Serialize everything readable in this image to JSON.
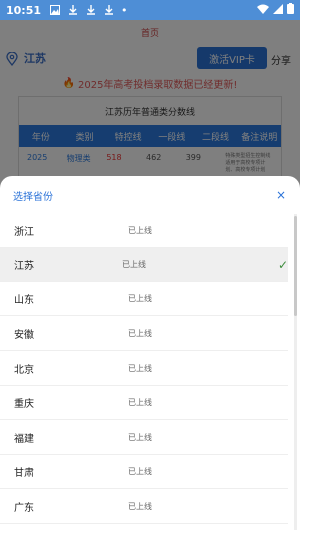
{
  "statusbar": {
    "time": "10:51",
    "dot": "•"
  },
  "appbar": {
    "title": "首页"
  },
  "filter": {
    "region": "江苏",
    "vip_label": "激活VIP卡",
    "share_label": "分享"
  },
  "banner": {
    "text": "2025年高考投档录取数据已经更新!"
  },
  "card": {
    "title": "江苏历年普通类分数线",
    "headers": [
      "年份",
      "类别",
      "特控线",
      "一段线",
      "二段线",
      "备注说明"
    ],
    "first_row": {
      "year": "2025",
      "type": "物理类",
      "special": "518",
      "one": "462",
      "two": "399",
      "note": "特殊类型招生控制线\n适用于高校专项计划、高校专项计划"
    }
  },
  "sheet": {
    "title": "选择省份",
    "close": "×",
    "provinces": [
      {
        "name": "浙江",
        "status": "已上线",
        "selected": false
      },
      {
        "name": "江苏",
        "status": "已上线",
        "selected": true
      },
      {
        "name": "山东",
        "status": "已上线",
        "selected": false
      },
      {
        "name": "安徽",
        "status": "已上线",
        "selected": false
      },
      {
        "name": "北京",
        "status": "已上线",
        "selected": false
      },
      {
        "name": "重庆",
        "status": "已上线",
        "selected": false
      },
      {
        "name": "福建",
        "status": "已上线",
        "selected": false
      },
      {
        "name": "甘肃",
        "status": "已上线",
        "selected": false
      },
      {
        "name": "广东",
        "status": "已上线",
        "selected": false
      }
    ],
    "check": "✓"
  },
  "colors": {
    "primary": "#2b73d6",
    "banner": "#e05a5a",
    "statusbar": "#4e8ed6"
  }
}
